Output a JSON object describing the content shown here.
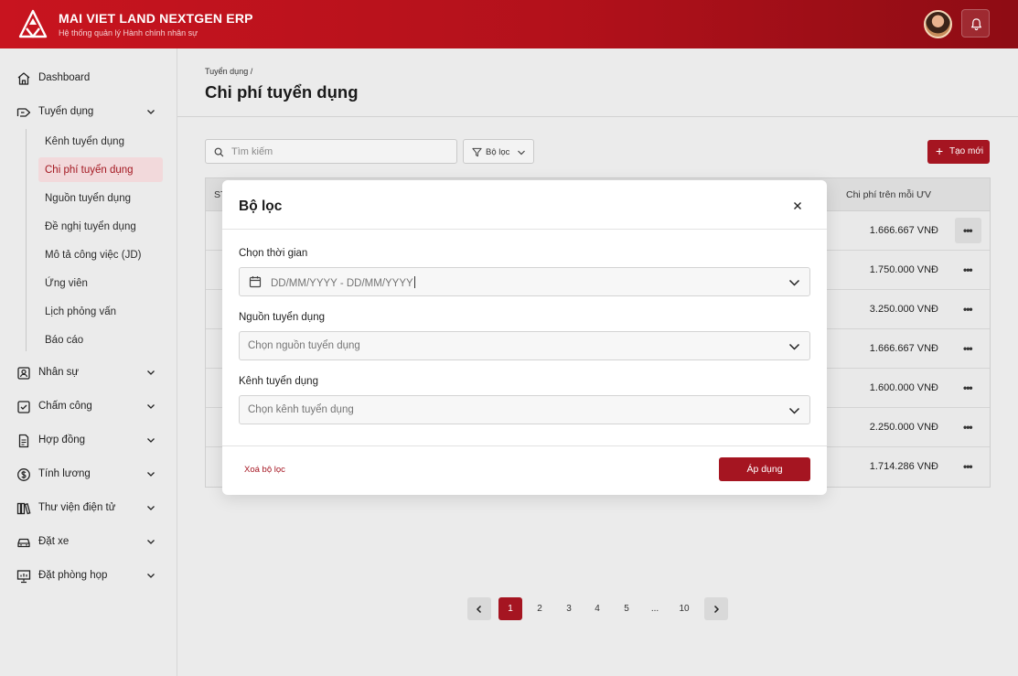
{
  "header": {
    "brand_title": "MAI VIET LAND NEXTGEN ERP",
    "brand_subtitle": "Hệ thống quản lý Hành chính nhân sự"
  },
  "sidebar": {
    "items": [
      {
        "label": "Dashboard",
        "icon": "home-icon"
      },
      {
        "label": "Tuyển dụng",
        "icon": "recruit-icon",
        "expanded": true
      },
      {
        "label": "Nhân sự",
        "icon": "id-card-icon"
      },
      {
        "label": "Chấm công",
        "icon": "timesheet-icon"
      },
      {
        "label": "Hợp đồng",
        "icon": "contract-icon"
      },
      {
        "label": "Tính lương",
        "icon": "dollar-icon"
      },
      {
        "label": "Thư viện điện tử",
        "icon": "library-icon"
      },
      {
        "label": "Đặt xe",
        "icon": "car-icon"
      },
      {
        "label": "Đặt phòng họp",
        "icon": "presentation-icon"
      }
    ],
    "sub_items": [
      {
        "label": "Kênh tuyển dụng"
      },
      {
        "label": "Chi phí tuyển dụng",
        "active": true
      },
      {
        "label": "Nguồn tuyển dụng"
      },
      {
        "label": "Đề nghị tuyển dụng"
      },
      {
        "label": "Mô tả công việc (JD)"
      },
      {
        "label": "Ứng viên"
      },
      {
        "label": "Lịch phỏng vấn"
      },
      {
        "label": "Báo cáo"
      }
    ]
  },
  "main": {
    "breadcrumb": "Tuyển dụng /",
    "title": "Chi phí tuyển dụng",
    "search_placeholder": "Tìm kiếm",
    "filter_label": "Bộ lọc",
    "create_label": "Tạo mới"
  },
  "table": {
    "col_stt": "ST",
    "col_cost": "Chi phí trên mỗi ƯV",
    "rows": [
      {
        "cost": "1.666.667 VNĐ"
      },
      {
        "cost": "1.750.000 VNĐ"
      },
      {
        "cost": "3.250.000 VNĐ"
      },
      {
        "cost": "1.666.667 VNĐ"
      },
      {
        "cost": "1.600.000 VNĐ"
      },
      {
        "cost": "2.250.000 VNĐ"
      },
      {
        "cost": "1.714.286 VNĐ"
      }
    ]
  },
  "pagination": {
    "pages": [
      "1",
      "2",
      "3",
      "4",
      "5",
      "...",
      "10"
    ],
    "current": "1"
  },
  "modal": {
    "title": "Bộ lọc",
    "time_label": "Chọn thời gian",
    "time_placeholder": "DD/MM/YYYY - DD/MM/YYYY",
    "source_label": "Nguồn tuyển dụng",
    "source_placeholder": "Chọn nguồn tuyển dụng",
    "channel_label": "Kênh tuyển dụng",
    "channel_placeholder": "Chọn kênh tuyển dụng",
    "clear_label": "Xoá bộ lọc",
    "apply_label": "Áp dụng"
  },
  "colors": {
    "brand": "#c8141f",
    "primary_button": "#a51521",
    "active_nav_bg": "#f2d9db"
  }
}
